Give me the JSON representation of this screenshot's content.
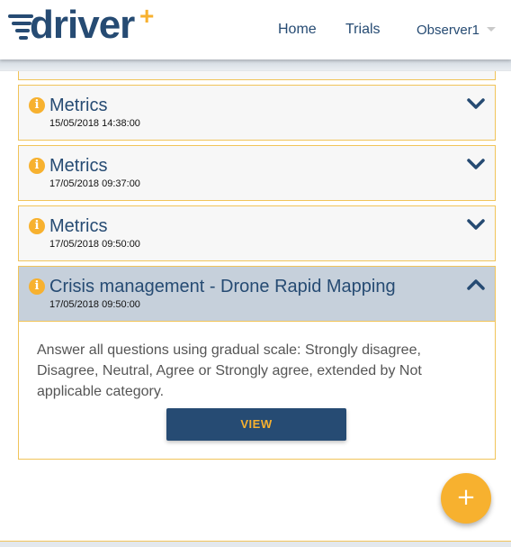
{
  "header": {
    "logo_text": "driver",
    "logo_plus": "+",
    "nav": {
      "home": "Home",
      "trials": "Trials",
      "user": "Observer1"
    }
  },
  "cards": [
    {
      "title": "Metrics",
      "date": "15/05/2018 14:38:00",
      "expanded": false
    },
    {
      "title": "Metrics",
      "date": "17/05/2018 09:37:00",
      "expanded": false
    },
    {
      "title": "Metrics",
      "date": "17/05/2018 09:50:00",
      "expanded": false
    },
    {
      "title": "Crisis management - Drone Rapid Mapping",
      "date": "17/05/2018 09:50:00",
      "expanded": true,
      "description": "Answer all questions using gradual scale: Strongly disagree, Disagree, Neutral, Agree or Strongly agree, extended by Not applicable category.",
      "button_label": "VIEW"
    }
  ],
  "fab_label": "+",
  "icons": {
    "info": "info-icon",
    "expand": "chevron-down-icon",
    "collapse": "chevron-up-icon",
    "add": "plus-icon"
  },
  "colors": {
    "brand_blue": "#264b73",
    "accent_yellow": "#f7b12f",
    "expanded_header": "#c6d0db"
  }
}
